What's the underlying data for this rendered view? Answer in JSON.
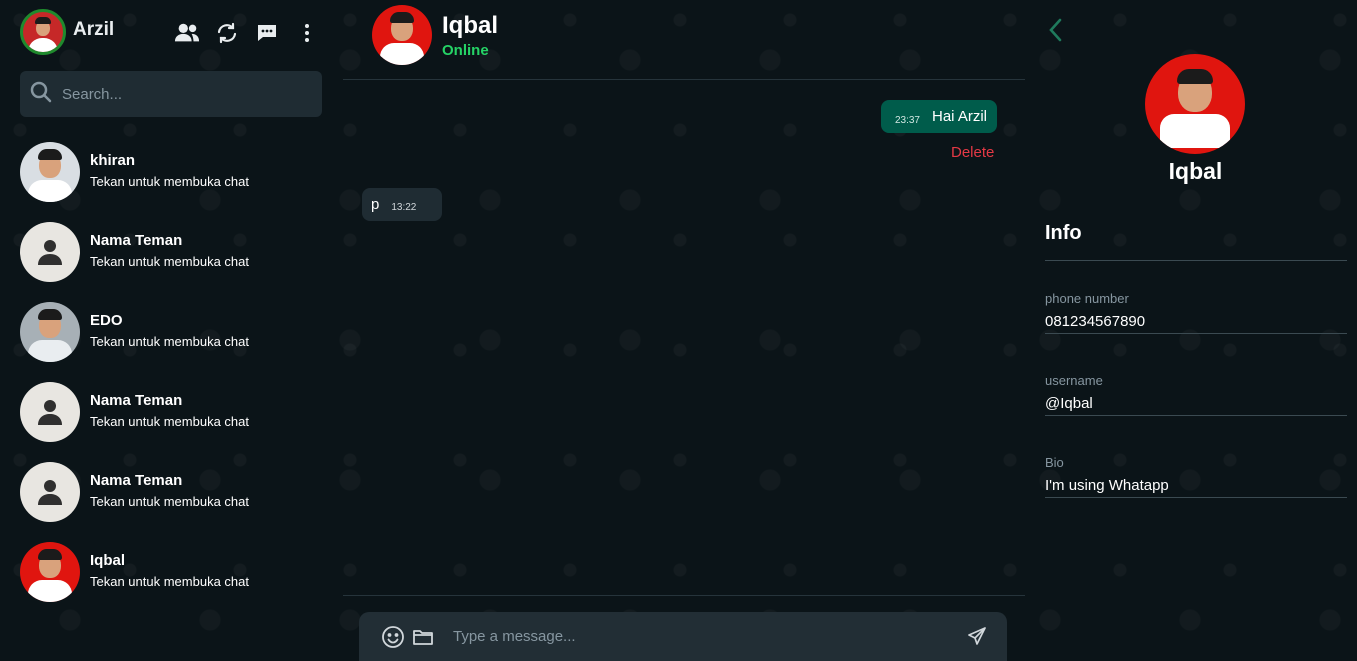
{
  "me": {
    "name": "Arzil"
  },
  "search": {
    "placeholder": "Search..."
  },
  "chats": [
    {
      "name": "khiran",
      "subtitle": "Tekan untuk membuka chat"
    },
    {
      "name": "Nama Teman",
      "subtitle": "Tekan untuk membuka chat"
    },
    {
      "name": "EDO",
      "subtitle": "Tekan untuk membuka chat"
    },
    {
      "name": "Nama Teman",
      "subtitle": "Tekan untuk membuka chat"
    },
    {
      "name": "Nama Teman",
      "subtitle": "Tekan untuk membuka chat"
    },
    {
      "name": "Iqbal",
      "subtitle": "Tekan untuk membuka chat"
    }
  ],
  "conversation": {
    "contact_name": "Iqbal",
    "status": "Online",
    "messages": [
      {
        "direction": "out",
        "text": "Hai Arzil",
        "time": "23:37"
      },
      {
        "direction": "in",
        "text": "p",
        "time": "13:22"
      }
    ],
    "delete_label": "Delete"
  },
  "composer": {
    "placeholder": "Type a message..."
  },
  "profile": {
    "name": "Iqbal",
    "info_title": "Info",
    "fields": [
      {
        "label": "phone number",
        "value": "081234567890"
      },
      {
        "label": "username",
        "value": "@Iqbal"
      },
      {
        "label": "Bio",
        "value": "I'm using Whatapp"
      }
    ]
  },
  "colors": {
    "background": "#0b1418",
    "outgoing_bubble": "#005c4b",
    "incoming_bubble": "#1f2c33",
    "online": "#25d366",
    "delete": "#e53945"
  }
}
